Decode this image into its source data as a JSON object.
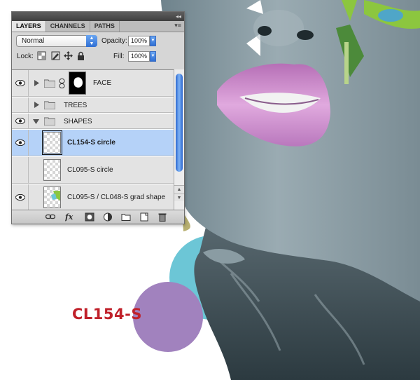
{
  "artwork": {
    "swatch_label": "CL154-S",
    "colors": {
      "lip": "#c98fcb",
      "skin": "#8fa2aa",
      "circle_cyan": "#6cc6d6",
      "circle_purple": "#a182be",
      "leaf_green": "#8cc63f",
      "label_red": "#c0202a"
    }
  },
  "panel": {
    "collapse_icon": "collapse-double-arrow-icon",
    "tabs": [
      {
        "label": "LAYERS",
        "active": true
      },
      {
        "label": "CHANNELS",
        "active": false
      },
      {
        "label": "PATHS",
        "active": false
      }
    ],
    "menu_icon": "panel-menu-icon",
    "blend_mode": "Normal",
    "opacity_label": "Opacity:",
    "opacity_value": "100%",
    "lock_label": "Lock:",
    "lock_icons": [
      "lock-transparency-icon",
      "lock-paint-icon",
      "lock-position-icon",
      "lock-all-icon"
    ],
    "fill_label": "Fill:",
    "fill_value": "100%",
    "layers": [
      {
        "name": "FACE",
        "type": "group",
        "visible": true,
        "expanded": false,
        "linked": true,
        "has_mask": true
      },
      {
        "name": "TREES",
        "type": "group",
        "visible": false,
        "expanded": false
      },
      {
        "name": "SHAPES",
        "type": "group",
        "visible": true,
        "expanded": true
      },
      {
        "name": "CL154-S circle",
        "type": "layer",
        "visible": true,
        "selected": true
      },
      {
        "name": "CL095-S circle",
        "type": "layer",
        "visible": false
      },
      {
        "name": "CL095-S / CL048-S grad shape",
        "type": "layer",
        "visible": true
      }
    ],
    "bottom_tools": [
      "link-layers-icon",
      "layer-style-fx-icon",
      "add-mask-icon",
      "adjustment-layer-icon",
      "new-group-icon",
      "new-layer-icon",
      "trash-icon"
    ]
  }
}
